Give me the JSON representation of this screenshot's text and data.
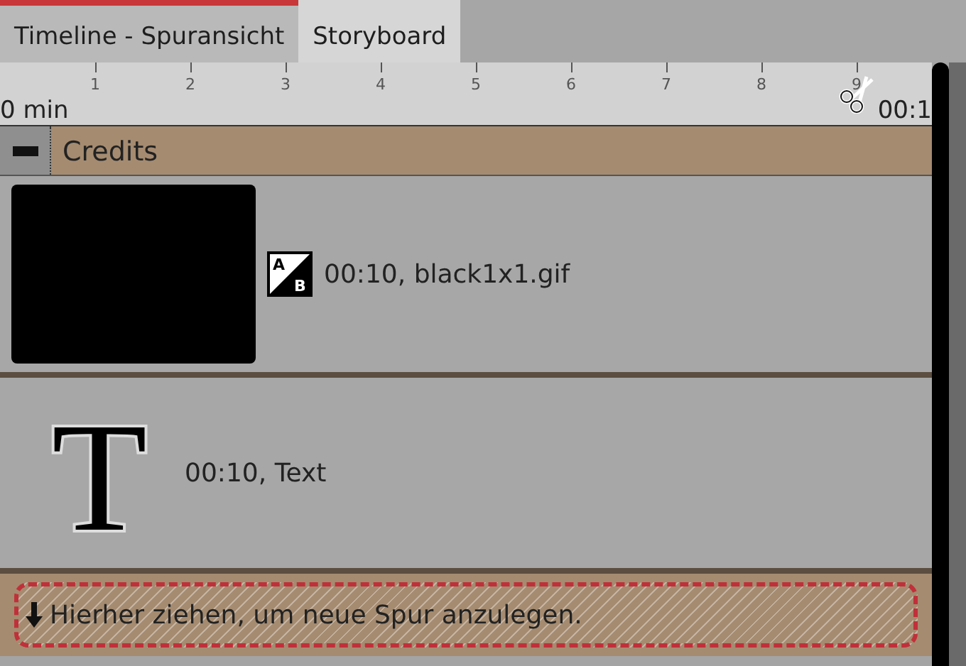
{
  "tabs": [
    {
      "label": "Timeline - Spuransicht",
      "selected": true
    },
    {
      "label": "Storyboard",
      "selected": false
    }
  ],
  "ruler": {
    "ticks": [
      "1",
      "2",
      "3",
      "4",
      "5",
      "6",
      "7",
      "8",
      "9"
    ],
    "start_label": "0 min",
    "end_label": "00:1"
  },
  "group": {
    "title": "Credits",
    "expanded": true
  },
  "clips": [
    {
      "kind": "image",
      "icon_letters": [
        "A",
        "B"
      ],
      "info": "00:10, black1x1.gif"
    },
    {
      "kind": "text",
      "icon_letters": [
        "T"
      ],
      "info": "00:10, Text"
    }
  ],
  "drop_zone": {
    "text": "Hierher ziehen, um neue Spur anzulegen."
  }
}
